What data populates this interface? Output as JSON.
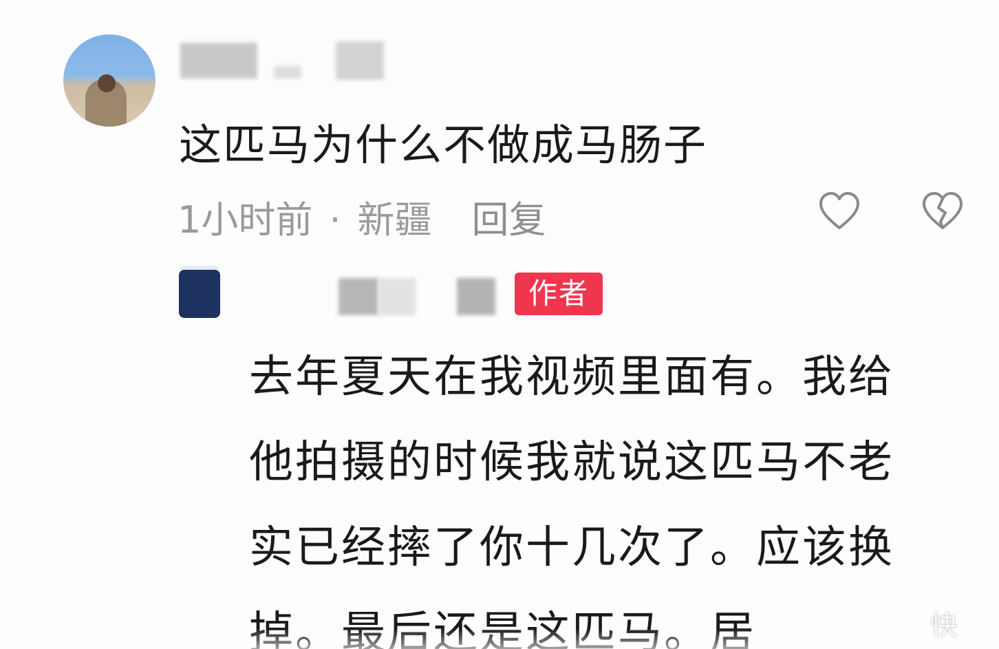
{
  "comment": {
    "text": "这匹马为什么不做成马肠子",
    "time": "1小时前",
    "separator": "·",
    "location": "新疆",
    "reply_label": "回复",
    "like_icon": "heart-outline-icon",
    "dislike_icon": "broken-heart-icon"
  },
  "reply": {
    "badge": "作者",
    "lines": [
      "去年夏天在我视频里面有。我给",
      "他拍摄的时候我就说这匹马不老",
      "实已经摔了你十几次了。应该换",
      "掉。最后还是这匹马。居"
    ]
  },
  "watermark": "快"
}
